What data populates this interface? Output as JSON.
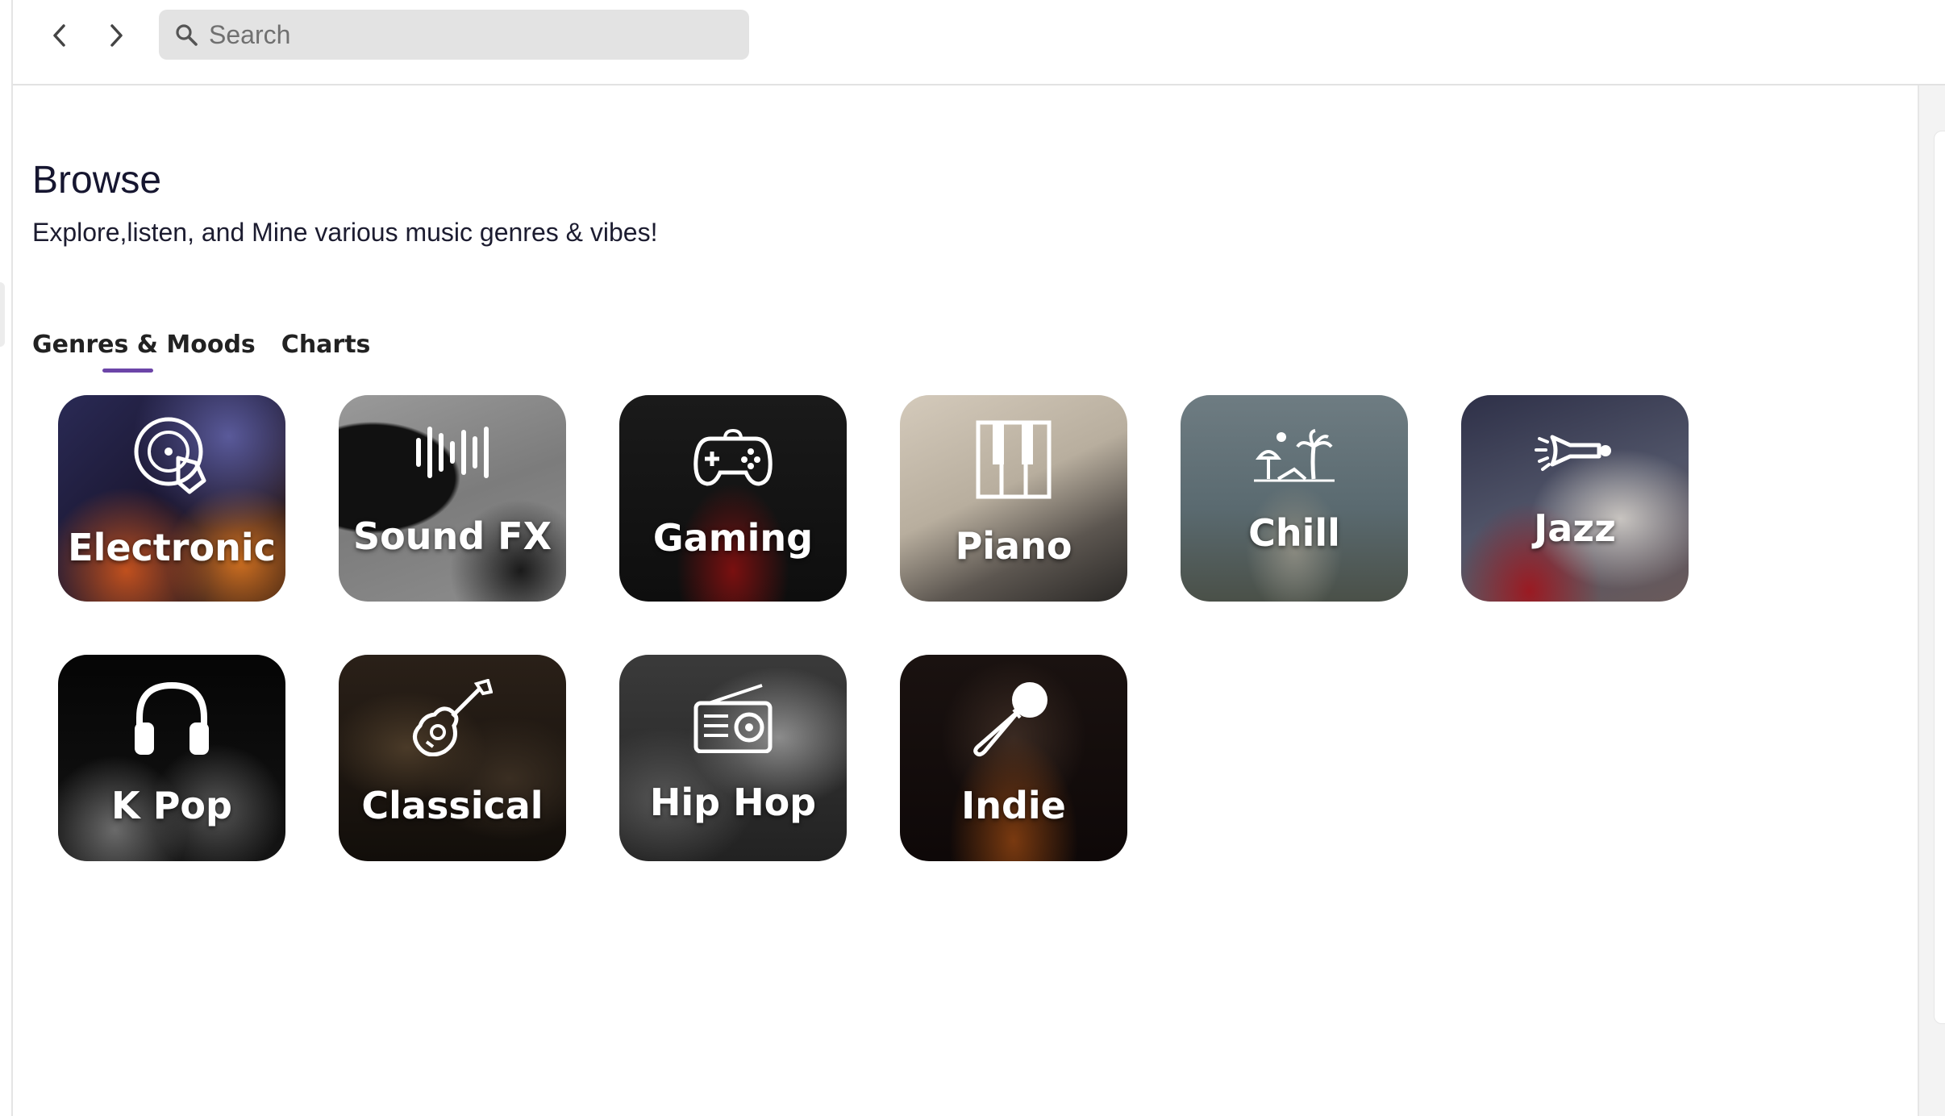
{
  "search": {
    "placeholder": "Search"
  },
  "page": {
    "title": "Browse",
    "subtitle": "Explore,listen, and Mine various music genres & vibes!"
  },
  "tabs": [
    {
      "label": "Genres & Moods",
      "active": true
    },
    {
      "label": "Charts",
      "active": false
    }
  ],
  "genres": [
    {
      "label": "Electronic",
      "icon": "dj-turntable-icon"
    },
    {
      "label": "Sound FX",
      "icon": "sound-wave-icon"
    },
    {
      "label": "Gaming",
      "icon": "gamepad-icon"
    },
    {
      "label": "Piano",
      "icon": "piano-keys-icon"
    },
    {
      "label": "Chill",
      "icon": "beach-palm-icon"
    },
    {
      "label": "Jazz",
      "icon": "trumpet-icon"
    },
    {
      "label": "K Pop",
      "icon": "headphones-icon"
    },
    {
      "label": "Classical",
      "icon": "guitar-icon"
    },
    {
      "label": "Hip Hop",
      "icon": "radio-icon"
    },
    {
      "label": "Indie",
      "icon": "microphone-icon"
    }
  ],
  "colors": {
    "accent": "#6c45a8",
    "search_bg": "#e3e3e3"
  }
}
